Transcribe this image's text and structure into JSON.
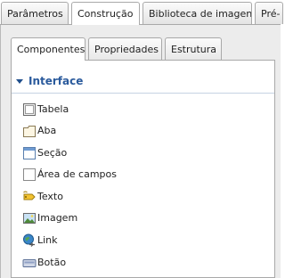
{
  "top_tabs": [
    {
      "label": "Parâmetros",
      "active": false
    },
    {
      "label": "Construção",
      "active": true
    },
    {
      "label": "Biblioteca de imagens",
      "active": false
    },
    {
      "label": "Pré-",
      "active": false
    }
  ],
  "inner_tabs": [
    {
      "label": "Componentes",
      "active": true
    },
    {
      "label": "Propriedades",
      "active": false
    },
    {
      "label": "Estrutura",
      "active": false
    }
  ],
  "section": {
    "title": "Interface"
  },
  "items": [
    {
      "label": "Tabela",
      "icon": "table-icon"
    },
    {
      "label": "Aba",
      "icon": "folder-tab-icon"
    },
    {
      "label": "Seção",
      "icon": "section-window-icon"
    },
    {
      "label": "Área de campos",
      "icon": "field-area-icon"
    },
    {
      "label": "Texto",
      "icon": "text-label-icon"
    },
    {
      "label": "Imagem",
      "icon": "image-icon"
    },
    {
      "label": "Link",
      "icon": "globe-link-icon"
    },
    {
      "label": "Botão",
      "icon": "button-icon"
    }
  ]
}
